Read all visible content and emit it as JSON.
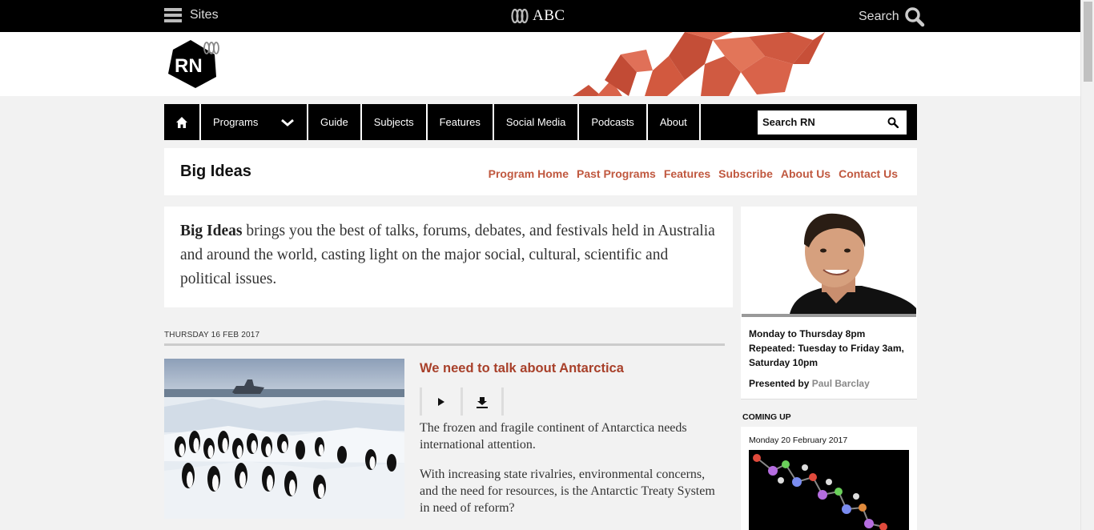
{
  "abc_bar": {
    "sites_label": "Sites",
    "logo_text": "ABC",
    "search_label": "Search"
  },
  "banner": {
    "logo_text": "RN"
  },
  "nav": {
    "programs_label": "Programs",
    "items": [
      "Guide",
      "Subjects",
      "Features",
      "Social Media",
      "Podcasts",
      "About"
    ],
    "search_placeholder": "Search RN"
  },
  "program": {
    "title": "Big Ideas",
    "links": [
      "Program Home",
      "Past Programs",
      "Features",
      "Subscribe",
      "About Us",
      "Contact Us"
    ],
    "intro_bold": "Big Ideas",
    "intro_text": " brings you the best of talks, forums, debates, and festivals held in Australia and around the world, casting light on the major social, cultural, scientific and political issues."
  },
  "episode": {
    "date": "THURSDAY 16 FEB 2017",
    "title": "We need to talk about Antarctica",
    "paragraphs": [
      "The frozen and fragile continent of Antarctica needs international attention.",
      "With increasing state rivalries, environmental concerns, and the need for resources, is the Antarctic Treaty System in need of reform?"
    ]
  },
  "sidebar": {
    "schedule_line1": "Monday to Thursday 8pm",
    "schedule_line2": "Repeated: Tuesday to Friday 3am, Saturday 10pm",
    "presented_by": "Presented by",
    "presenter_name": "Paul Barclay",
    "coming_up_label": "COMING UP",
    "coming_up_date": "Monday 20 February 2017"
  },
  "colors": {
    "link_accent": "#c0583f",
    "title_accent": "#a8402a",
    "nav_bg": "#000000",
    "banner_art": "#d9634a"
  },
  "icons": [
    "hamburger-icon",
    "abc-logo-icon",
    "search-icon",
    "home-icon",
    "chevron-down-icon",
    "play-icon",
    "download-icon"
  ]
}
